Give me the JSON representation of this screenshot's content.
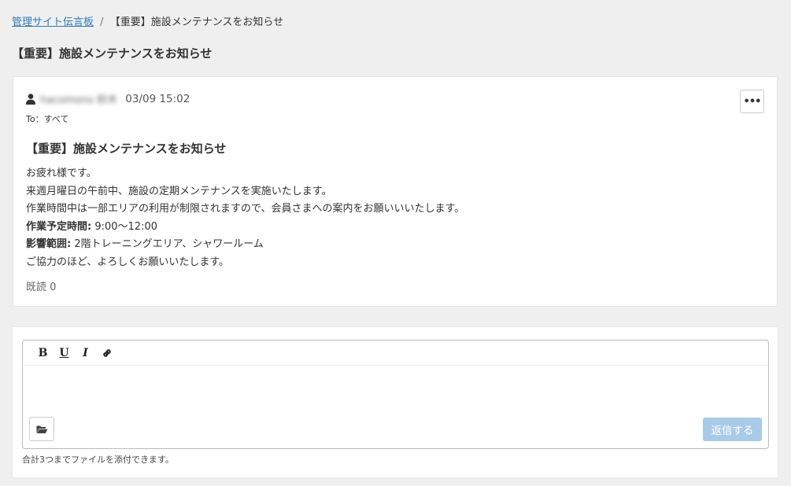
{
  "breadcrumb": {
    "parent": "管理サイト伝言板",
    "separator": "/",
    "current": "【重要】施設メンテナンスをお知らせ"
  },
  "page_title": "【重要】施設メンテナンスをお知らせ",
  "post": {
    "author": "hacomono 鈴木",
    "timestamp": "03/09 15:02",
    "to": "To：すべて",
    "menu_label": "•••",
    "title": "【重要】施設メンテナンスをお知らせ",
    "body_lines": [
      "お疲れ様です。",
      "来週月曜日の午前中、施設の定期メンテナンスを実施いたします。",
      "作業時間中は一部エリアの利用が制限されますので、会員さまへの案内をお願いいいたします。"
    ],
    "schedule_label": "作業予定時間:",
    "schedule_value": " 9:00〜12:00",
    "scope_label": "影響範囲:",
    "scope_value": " 2階トレーニングエリア、シャワールーム",
    "closing": "ご協力のほど、よろしくお願いいたします。",
    "read_count": "既読 0"
  },
  "reply": {
    "toolbar": {
      "bold": "B",
      "underline": "U",
      "italic": "I"
    },
    "input_value": "",
    "submit_label": "返信する",
    "attach_note": "合計3つまでファイルを添付できます。"
  },
  "colors": {
    "link": "#337ab7",
    "submit_disabled": "#a9cbe8",
    "background": "#efefef"
  }
}
